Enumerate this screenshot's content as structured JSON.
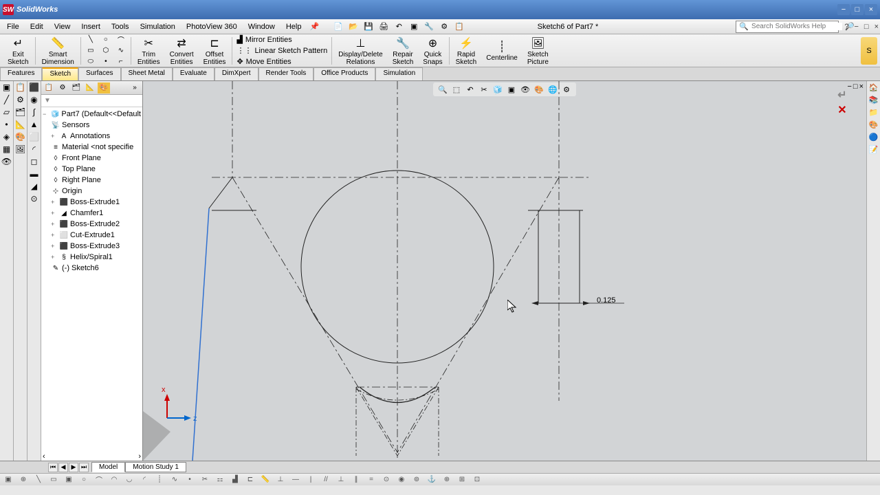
{
  "app": {
    "name": "SolidWorks"
  },
  "document_title": "Sketch6 of Part7 *",
  "menus": [
    "File",
    "Edit",
    "View",
    "Insert",
    "Tools",
    "Simulation",
    "PhotoView 360",
    "Window",
    "Help"
  ],
  "search_placeholder": "Search SolidWorks Help",
  "command_manager": {
    "exit_sketch": "Exit\nSketch",
    "smart_dimension": "Smart\nDimension",
    "trim": "Trim\nEntities",
    "convert": "Convert\nEntities",
    "offset": "Offset\nEntities",
    "mirror": "Mirror Entities",
    "linear_pattern": "Linear Sketch Pattern",
    "move": "Move Entities",
    "display_delete": "Display/Delete\nRelations",
    "repair": "Repair\nSketch",
    "quick_snaps": "Quick\nSnaps",
    "rapid_sketch": "Rapid\nSketch",
    "centerline": "Centerline",
    "sketch_picture": "Sketch\nPicture"
  },
  "tabs": [
    "Features",
    "Sketch",
    "Surfaces",
    "Sheet Metal",
    "Evaluate",
    "DimXpert",
    "Render Tools",
    "Office Products",
    "Simulation"
  ],
  "active_tab": "Sketch",
  "tree": {
    "root": "Part7  (Default<<Default",
    "items": [
      {
        "label": "Sensors",
        "icon": "sensor"
      },
      {
        "label": "Annotations",
        "icon": "annotation",
        "expandable": true
      },
      {
        "label": "Material <not specifie",
        "icon": "material"
      },
      {
        "label": "Front Plane",
        "icon": "plane"
      },
      {
        "label": "Top Plane",
        "icon": "plane"
      },
      {
        "label": "Right Plane",
        "icon": "plane"
      },
      {
        "label": "Origin",
        "icon": "origin"
      },
      {
        "label": "Boss-Extrude1",
        "icon": "extrude",
        "expandable": true
      },
      {
        "label": "Chamfer1",
        "icon": "chamfer",
        "expandable": true
      },
      {
        "label": "Boss-Extrude2",
        "icon": "extrude",
        "expandable": true
      },
      {
        "label": "Cut-Extrude1",
        "icon": "cut",
        "expandable": true
      },
      {
        "label": "Boss-Extrude3",
        "icon": "extrude",
        "expandable": true
      },
      {
        "label": "Helix/Spiral1",
        "icon": "helix",
        "expandable": true
      },
      {
        "label": "(-) Sketch6",
        "icon": "sketch"
      }
    ]
  },
  "dimension": {
    "value": "0.125"
  },
  "triad": {
    "x": "x",
    "z": "z"
  },
  "bottom_tabs": [
    "Model",
    "Motion Study 1"
  ],
  "active_bottom_tab": "Model"
}
